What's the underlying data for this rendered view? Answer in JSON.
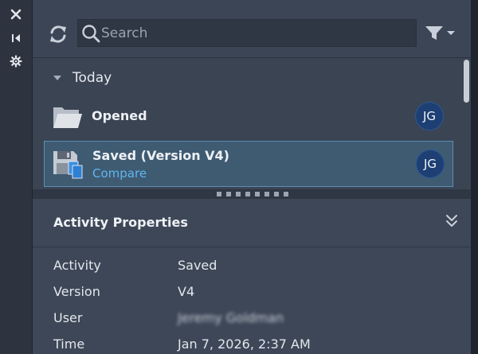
{
  "toolbar": {
    "search_placeholder": "Search",
    "refresh_icon": "refresh-icon",
    "filter_icon": "filter-icon"
  },
  "side_tools": [
    "close-icon",
    "collapse-panel-icon",
    "settings-icon"
  ],
  "activity": {
    "group_label": "Today",
    "items": [
      {
        "title": "Opened",
        "link": "",
        "initials": "JG",
        "icon": "folder-open-icon"
      },
      {
        "title": "Saved (Version V4)",
        "link": "Compare",
        "initials": "JG",
        "icon": "save-version-icon"
      }
    ]
  },
  "properties": {
    "title": "Activity Properties",
    "rows": [
      {
        "key": "Activity",
        "value": "Saved"
      },
      {
        "key": "Version",
        "value": "V4"
      },
      {
        "key": "User",
        "value": "Jeremy Goldman"
      },
      {
        "key": "Time",
        "value": "Jan 7, 2026, 2:37 AM"
      }
    ]
  },
  "colors": {
    "selection_bg": "#3f5b72",
    "selection_border": "#5b8eb3",
    "link": "#5fb6f0",
    "avatar": "#1d3f73"
  }
}
